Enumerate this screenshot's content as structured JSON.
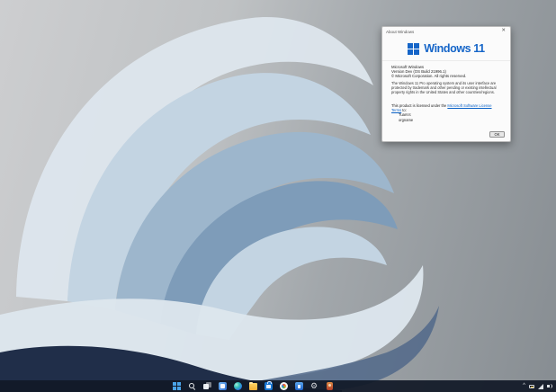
{
  "colors": {
    "accent_blue": "#1565c8",
    "link_blue": "#0b62c6",
    "taskbar_bg": "#111927",
    "wallpaper_bg_light": "#cdced0",
    "wallpaper_bg_dark": "#878d92",
    "petal_pale": "#dde6ed",
    "petal_light": "#c3d4e2",
    "petal_mid": "#9db6cc",
    "petal_deep": "#7e9cb9",
    "petal_dark_navy": "#202e49",
    "petal_shadow": "#51688a"
  },
  "dialog": {
    "title": "About Windows",
    "close_icon": "✕",
    "brand_name": "Windows 11",
    "lines": {
      "product": "Microsoft Windows",
      "version": "Version Dev (OS Build 21996.1)",
      "copyright": "© Microsoft Corporation. All rights reserved.",
      "legal": "The Windows 11 Pro operating system and its user interface are protected by trademark and other pending or existing intellectual property rights in the United States and other countries/regions."
    },
    "license": {
      "prefix": "This product is licensed under the ",
      "link": "Microsoft Software License Terms",
      "suffix": " to:",
      "licensee": "TuanVc",
      "organization": "orgname"
    },
    "ok_label": "OK"
  },
  "taskbar": {
    "icons": [
      {
        "id": "start",
        "label": "Start"
      },
      {
        "id": "search",
        "label": "Search"
      },
      {
        "id": "taskview",
        "label": "Task View"
      },
      {
        "id": "widgets",
        "label": "Widgets"
      },
      {
        "id": "edge",
        "label": "Microsoft Edge"
      },
      {
        "id": "explorer",
        "label": "File Explorer"
      },
      {
        "id": "store",
        "label": "Microsoft Store"
      },
      {
        "id": "photos",
        "label": "Photos"
      },
      {
        "id": "blueapp",
        "label": "Mail"
      },
      {
        "id": "settings",
        "label": "Settings"
      },
      {
        "id": "orangeapp",
        "label": "App"
      }
    ],
    "tray": {
      "chevron": "^",
      "icons": [
        {
          "id": "battery",
          "label": "Battery"
        },
        {
          "id": "network",
          "label": "Network"
        },
        {
          "id": "volume",
          "label": "Volume"
        }
      ]
    }
  }
}
